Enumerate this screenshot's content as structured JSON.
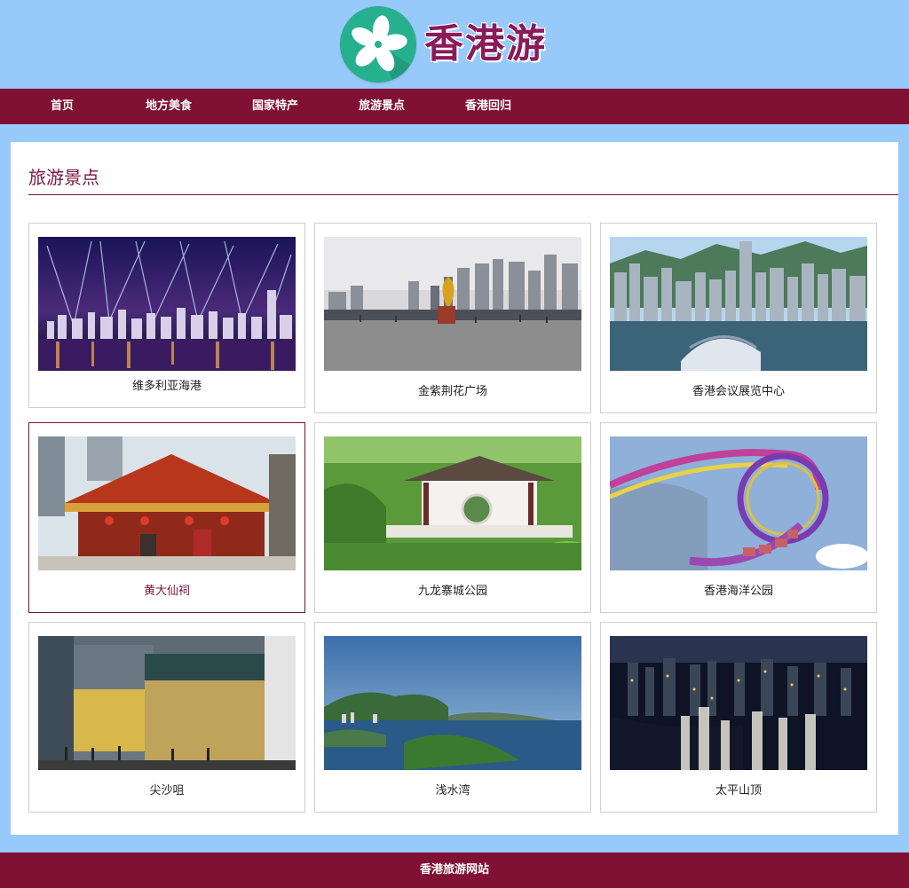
{
  "header": {
    "logo_text": "香港游",
    "logo_icon": "bauhinia-flower-icon"
  },
  "nav": {
    "items": [
      {
        "label": "首页"
      },
      {
        "label": "地方美食"
      },
      {
        "label": "国家特产"
      },
      {
        "label": "旅游景点"
      },
      {
        "label": "香港回归"
      }
    ]
  },
  "section": {
    "title": "旅游景点"
  },
  "attractions": [
    {
      "name": "维多利亚海港",
      "photo": "harbour-night-lights"
    },
    {
      "name": "金紫荆花广场",
      "photo": "golden-bauhinia-square"
    },
    {
      "name": "香港会议展览中心",
      "photo": "convention-centre"
    },
    {
      "name": "黄大仙祠",
      "photo": "temple"
    },
    {
      "name": "九龙寨城公园",
      "photo": "park-pavilion"
    },
    {
      "name": "香港海洋公园",
      "photo": "roller-coaster"
    },
    {
      "name": "尖沙咀",
      "photo": "shopping-street"
    },
    {
      "name": "浅水湾",
      "photo": "bay-coast"
    },
    {
      "name": "太平山顶",
      "photo": "city-night-view"
    }
  ],
  "footer": {
    "text": "香港旅游网站"
  },
  "colors": {
    "page_bg": "#97c9fb",
    "brand": "#801134",
    "logo_green": "#27b08e"
  }
}
